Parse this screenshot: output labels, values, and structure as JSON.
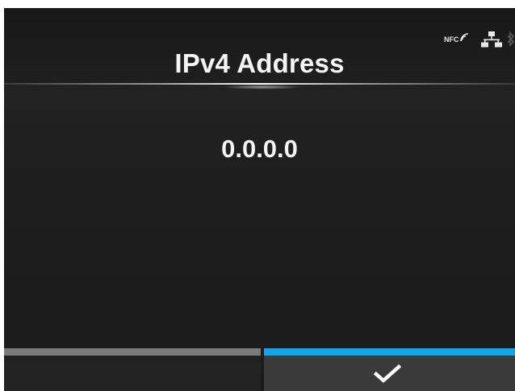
{
  "header": {
    "title": "IPv4 Address",
    "status_icons": {
      "nfc_label": "NFC",
      "icons": [
        "nfc-icon",
        "network-icon",
        "bluetooth-icon"
      ]
    }
  },
  "main": {
    "value": "0.0.0.0"
  },
  "bottom_bar": {
    "left_button": {
      "icon": "none"
    },
    "right_button": {
      "icon": "check-icon"
    }
  },
  "colors": {
    "background": "#1e1e1e",
    "text": "#f4f4f4",
    "accent_selected": "#12a7e8",
    "accent_unselected": "#7b7b7b"
  }
}
